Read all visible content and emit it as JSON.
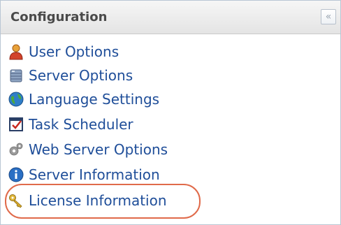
{
  "panel": {
    "title": "Configuration",
    "collapse_glyph": "«"
  },
  "menu": {
    "items": [
      {
        "label": "User Options",
        "icon": "user-icon"
      },
      {
        "label": "Server Options",
        "icon": "database-icon"
      },
      {
        "label": "Language Settings",
        "icon": "globe-icon"
      },
      {
        "label": "Task Scheduler",
        "icon": "calendar-check-icon"
      },
      {
        "label": "Web Server Options",
        "icon": "gear-icon"
      },
      {
        "label": "Server Information",
        "icon": "info-icon"
      },
      {
        "label": "License Information",
        "icon": "key-icon"
      }
    ]
  },
  "colors": {
    "link": "#1f4e99",
    "highlight": "#e06a4a"
  }
}
